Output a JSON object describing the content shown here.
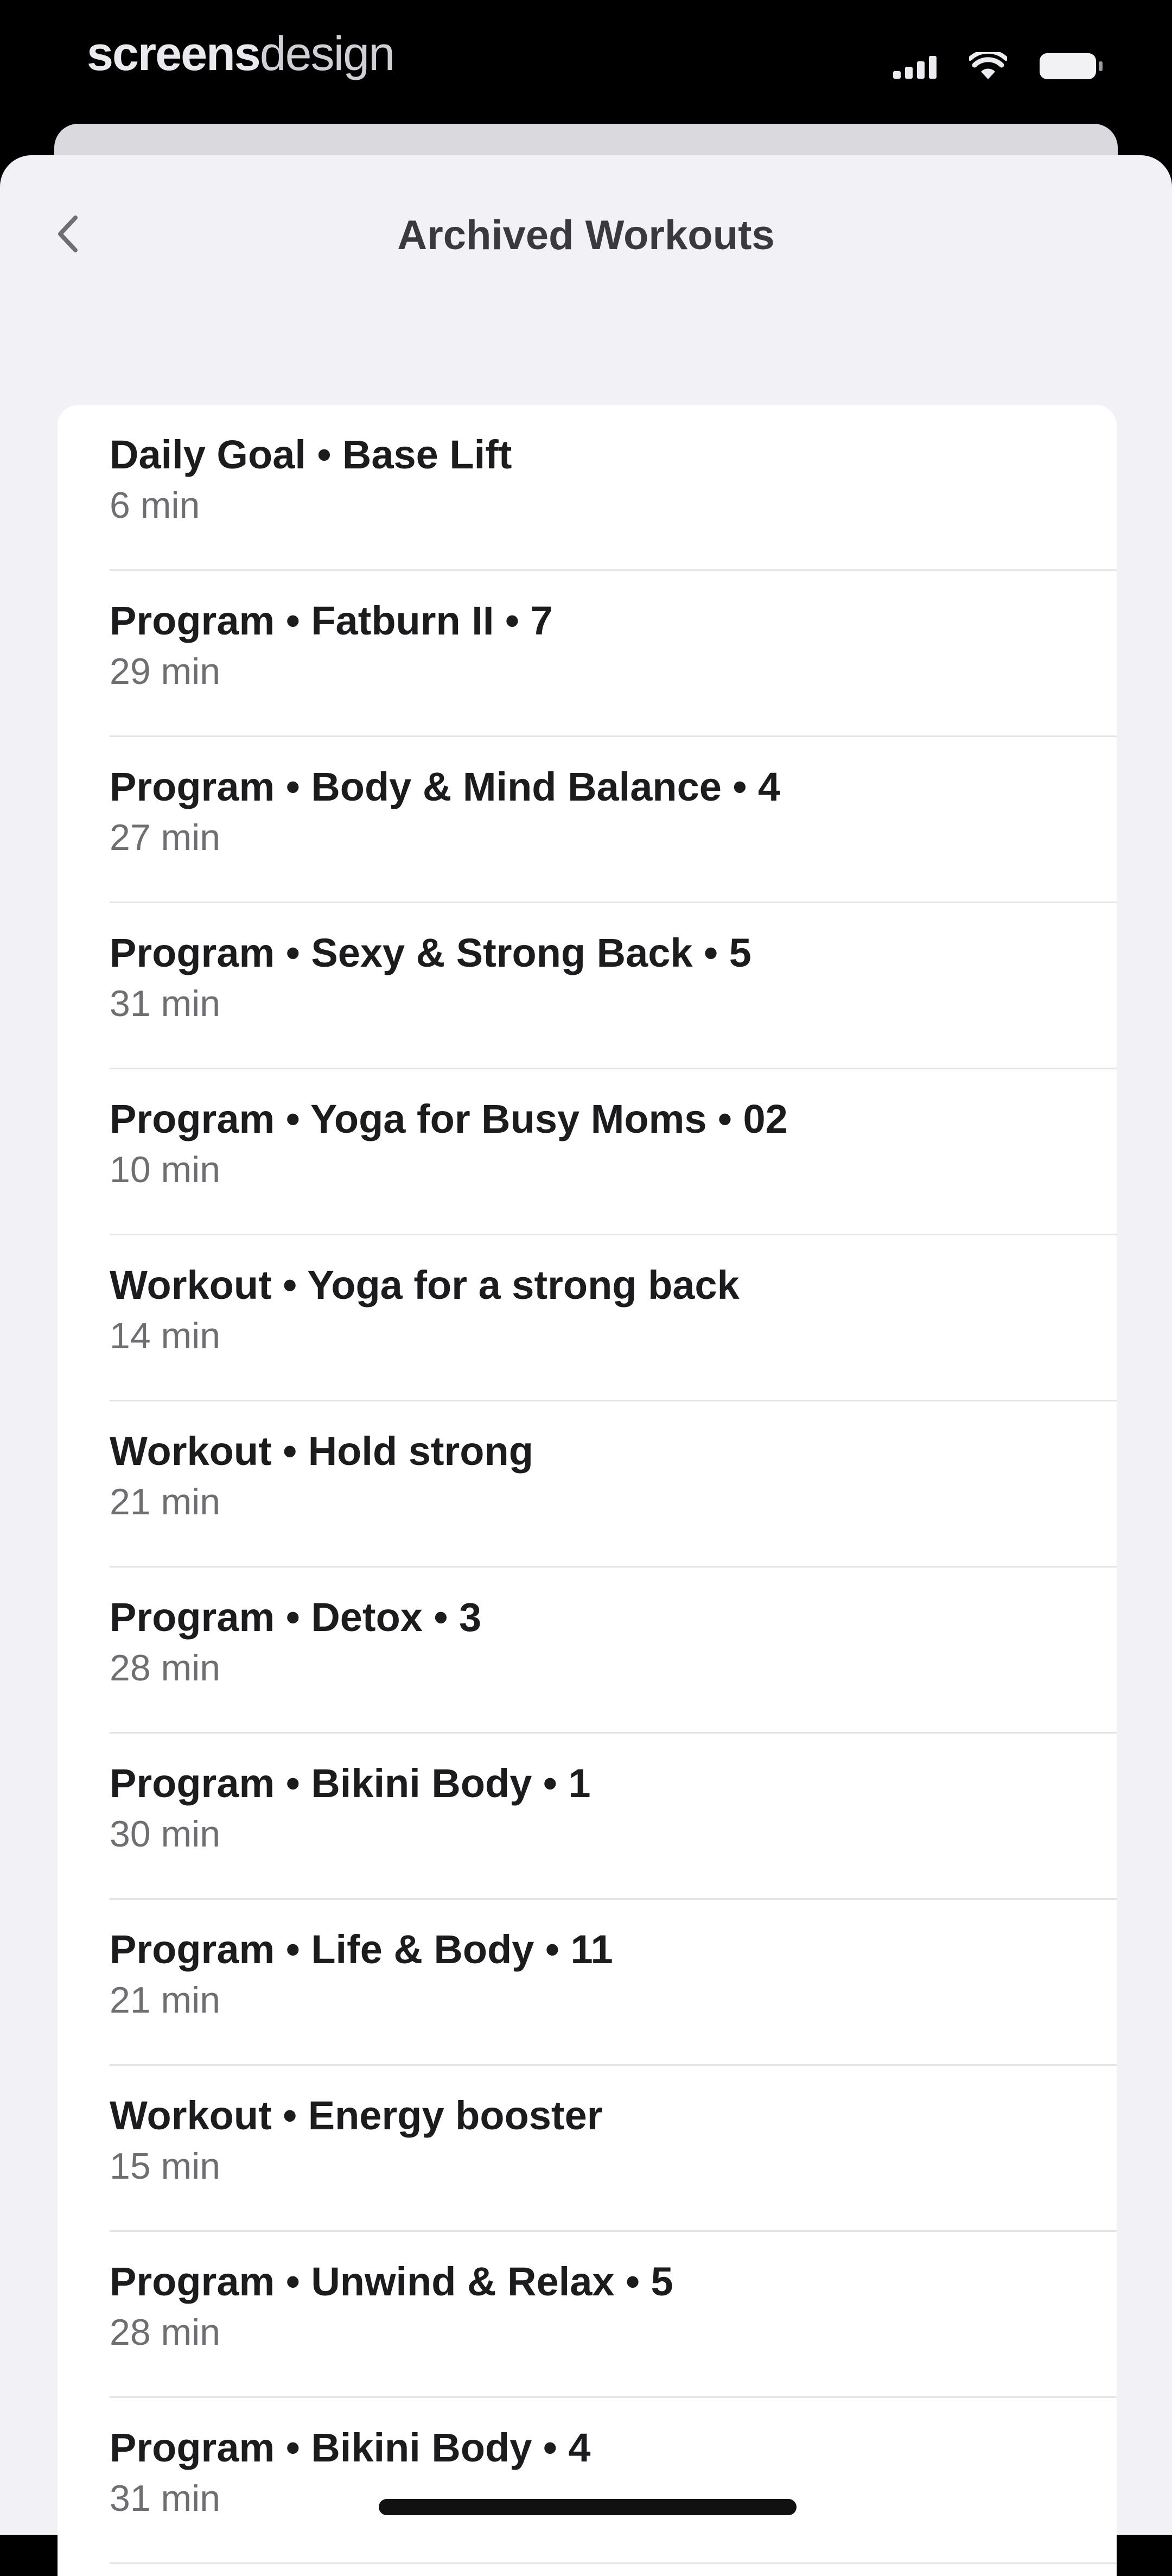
{
  "status_bar": {
    "brand_bold": "screens",
    "brand_light": "design",
    "icons": [
      "cellular-signal-icon",
      "wifi-icon",
      "battery-icon"
    ]
  },
  "nav": {
    "back_icon": "chevron-left-icon",
    "title": "Archived Workouts"
  },
  "workouts": [
    {
      "title": "Daily Goal • Base Lift",
      "duration": "6 min"
    },
    {
      "title": "Program • Fatburn II • 7",
      "duration": "29 min"
    },
    {
      "title": "Program • Body & Mind Balance • 4",
      "duration": "27 min"
    },
    {
      "title": "Program • Sexy & Strong Back • 5",
      "duration": "31 min"
    },
    {
      "title": "Program • Yoga for Busy Moms • 02",
      "duration": "10 min"
    },
    {
      "title": "Workout • Yoga for a strong back",
      "duration": "14 min"
    },
    {
      "title": "Workout • Hold strong",
      "duration": "21 min"
    },
    {
      "title": "Program • Detox • 3",
      "duration": "28 min"
    },
    {
      "title": "Program • Bikini Body • 1",
      "duration": "30 min"
    },
    {
      "title": "Program • Life & Body • 11",
      "duration": "21 min"
    },
    {
      "title": "Workout • Energy booster",
      "duration": "15 min"
    },
    {
      "title": "Program • Unwind & Relax • 5",
      "duration": "28 min"
    },
    {
      "title": "Program • Bikini Body • 4",
      "duration": "31 min"
    }
  ],
  "colors": {
    "background": "#f1f1f6",
    "card": "#ffffff",
    "title_text": "#1c1c1e",
    "subtitle_text": "#6e6e73",
    "separator": "#e3e3e8"
  }
}
